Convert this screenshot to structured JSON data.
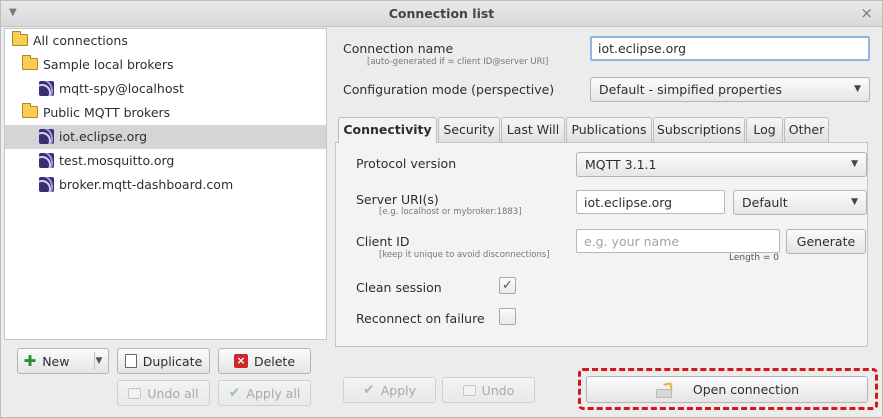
{
  "window": {
    "title": "Connection list"
  },
  "tree": {
    "root": "All connections",
    "groups": [
      {
        "label": "Sample local brokers",
        "items": [
          "mqtt-spy@localhost"
        ]
      },
      {
        "label": "Public MQTT brokers",
        "items": [
          "iot.eclipse.org",
          "test.mosquitto.org",
          "broker.mqtt-dashboard.com"
        ]
      }
    ],
    "selected": "iot.eclipse.org"
  },
  "left_buttons": {
    "new": "New",
    "duplicate": "Duplicate",
    "delete": "Delete",
    "undo_all": "Undo all",
    "apply_all": "Apply all"
  },
  "form": {
    "connection_name_label": "Connection name",
    "connection_name_hint": "[auto-generated if = client ID@server URI]",
    "connection_name_value": "iot.eclipse.org",
    "config_mode_label": "Configuration mode (perspective)",
    "config_mode_value": "Default - simpified properties"
  },
  "tabs": [
    "Connectivity",
    "Security",
    "Last Will",
    "Publications",
    "Subscriptions",
    "Log",
    "Other"
  ],
  "active_tab": "Connectivity",
  "connectivity": {
    "protocol_label": "Protocol version",
    "protocol_value": "MQTT 3.1.1",
    "server_label": "Server URI(s)",
    "server_hint": "[e.g. localhost or mybroker:1883]",
    "server_value": "iot.eclipse.org",
    "server_mode_value": "Default",
    "client_id_label": "Client ID",
    "client_id_hint": "[keep it unique to avoid disconnections]",
    "client_id_placeholder": "e.g. your name",
    "client_id_length": "Length = 0",
    "generate_button": "Generate",
    "clean_session_label": "Clean session",
    "clean_session_checked": true,
    "reconnect_label": "Reconnect on failure",
    "reconnect_checked": false
  },
  "bottom_buttons": {
    "apply": "Apply",
    "undo": "Undo",
    "open_connection": "Open connection"
  },
  "colors": {
    "highlight": "#d9141b",
    "selection": "#d5d5d5",
    "focus_border": "#8fb4e6"
  }
}
